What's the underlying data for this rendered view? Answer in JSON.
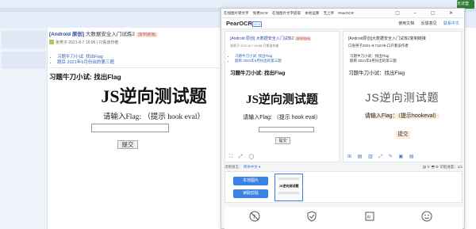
{
  "browser": {
    "corner_label": "无法登录"
  },
  "blog": {
    "title_prefix": "[Android 原创]",
    "title": "大数据安全入门试炼2",
    "title_tag": "[复制链接]",
    "author": "张男子",
    "date": "2021-8-7 16:06",
    "only_author": "只看该作者",
    "links": [
      "习题牛刀小试: 找出Flag",
      "题目 2021年6月份出的第三题"
    ],
    "heading": "习题牛刀小试: 找出Flag",
    "big_title": "JS逆向测试题",
    "prompt": "请输入Flag: （提示 hook eval）",
    "submit": "提交"
  },
  "ocr": {
    "tabs": [
      "在线图片转文字",
      "免费OCR",
      "在线图片文字提取",
      "本地运算",
      "无上传",
      "PearOCR"
    ],
    "app_name": "PearOCR",
    "version": "V1.6",
    "menu": [
      "使用文档",
      "反馈意见",
      "联系中文"
    ],
    "left": {
      "title_prefix": "[Android 原创]",
      "title": "大数据安全入门试炼2",
      "tag": "[复制链接]",
      "meta": "张男子 2021-8-7 16:06  只看该作者",
      "links": [
        "习题牛刀小试: 找出Flag",
        "题目 2021年6月份出的第三题"
      ],
      "heading": "习题牛刀小试: 找出Flag",
      "big": "JS逆向测试题",
      "prompt": "请输入Flag: （提示 hook eval）",
      "submit": "提交"
    },
    "right": {
      "title": "[Android原创]大数据安全入门试炼2复制链接",
      "meta": "口张男子2021-8-716:06-口只看该作者",
      "links": [
        "习题牛刀小试：找出Flag",
        "题目 2021年6月份出的第三题"
      ],
      "heading": "习题牛刀小试：找出Flag",
      "big": "JS逆向测试题",
      "prompt": "请输入Flag：（提示hookeval）",
      "submit": "提交"
    },
    "controls": {
      "label": "识别语言：",
      "lang": "简体中文",
      "progress": "识别进度：1/1"
    },
    "upload_local": "本地图片",
    "paste": "读取剪贴",
    "thumb_title": "JS逆向测试题",
    "icons": [
      "no-text-icon",
      "shield-check-icon",
      "ai-chip-icon",
      "smile-icon"
    ]
  }
}
